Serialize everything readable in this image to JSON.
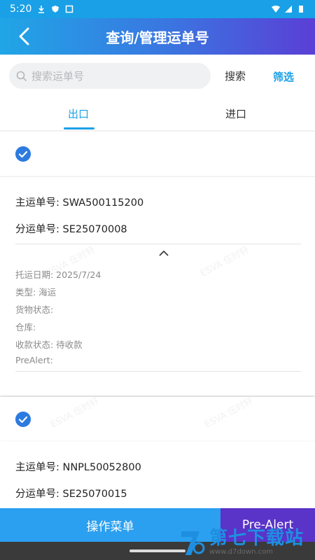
{
  "status_bar": {
    "time": "5:20"
  },
  "nav": {
    "title": "查询/管理运单号"
  },
  "search": {
    "placeholder": "搜索运单号",
    "search_label": "搜索",
    "filter_label": "筛选"
  },
  "tabs": [
    {
      "label": "出口",
      "active": true
    },
    {
      "label": "进口",
      "active": false
    }
  ],
  "cards": [
    {
      "master_no": "主运单号: SWA500115200",
      "sub_no": "分运单号: SE25070008",
      "details": [
        "托运日期: 2025/7/24",
        "类型: 海运",
        "货物状态:",
        "仓库:",
        "收款状态: 待收款",
        "PreAlert:"
      ]
    },
    {
      "master_no": "主运单号: NNPL50052800",
      "sub_no": "分运单号: SE25070015"
    }
  ],
  "watermark": "ESVA 伍时轩",
  "bottom": {
    "menu_label": "操作菜单",
    "prealert_label": "Pre-Alert"
  },
  "logo": {
    "name": "第七下载站",
    "url": "www.d7down.com"
  },
  "colors": {
    "accent": "#1aa0e6",
    "check": "#2d7be0",
    "menu_btn": "#2b9ff0",
    "prealert_btn": "#5a33c8"
  }
}
